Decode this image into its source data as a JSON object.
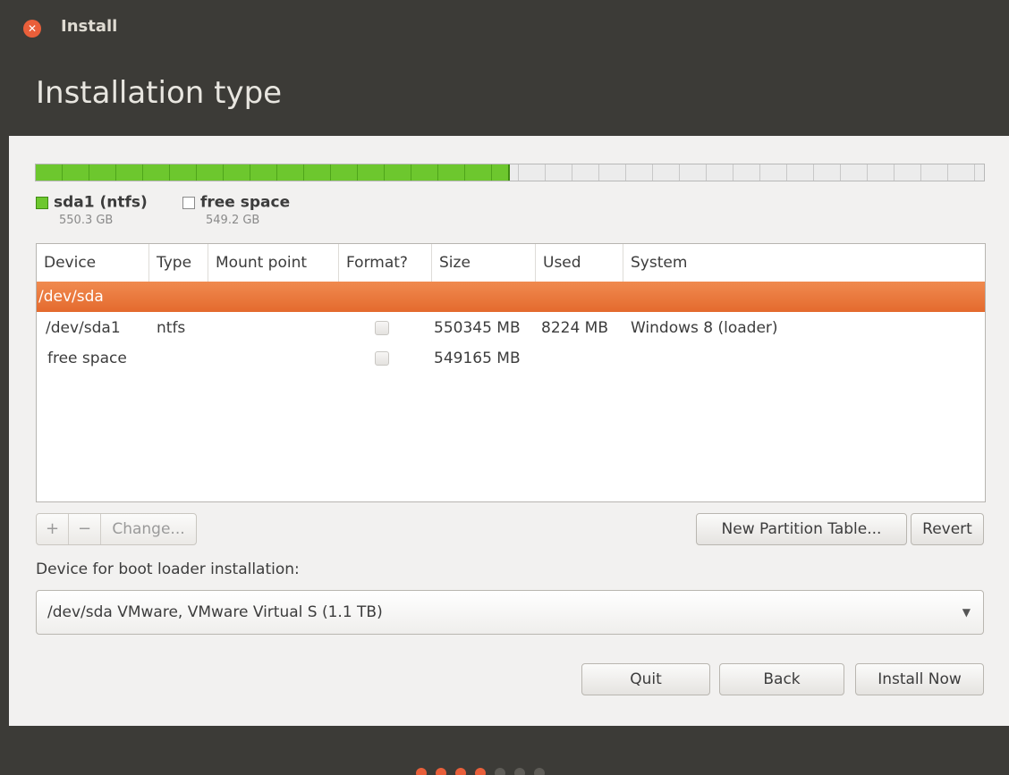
{
  "window": {
    "title": "Install",
    "close_icon": "close-icon"
  },
  "page": {
    "heading": "Installation type"
  },
  "disk_bar": {
    "used_fraction": 0.5,
    "used_color": "#6dc72e",
    "free_color": "#ececec"
  },
  "legend": [
    {
      "name": "sda1 (ntfs)",
      "size": "550.3 GB",
      "color": "#6dc72e"
    },
    {
      "name": "free space",
      "size": "549.2 GB",
      "color": "#ffffff"
    }
  ],
  "table": {
    "headers": [
      "Device",
      "Type",
      "Mount point",
      "Format?",
      "Size",
      "Used",
      "System"
    ],
    "rows": [
      {
        "device": "/dev/sda",
        "type": "",
        "mount": "",
        "format": null,
        "size": "",
        "used": "",
        "system": "",
        "selected": true
      },
      {
        "device": "/dev/sda1",
        "type": "ntfs",
        "mount": "",
        "format": false,
        "size": "550345 MB",
        "used": "8224 MB",
        "system": "Windows 8 (loader)",
        "selected": false
      },
      {
        "device": "free space",
        "type": "",
        "mount": "",
        "format": false,
        "size": "549165 MB",
        "used": "",
        "system": "",
        "selected": false
      }
    ]
  },
  "toolbar": {
    "add_label": "+",
    "remove_label": "−",
    "change_label": "Change...",
    "new_table_label": "New Partition Table...",
    "revert_label": "Revert"
  },
  "bootloader": {
    "label": "Device for boot loader installation:",
    "selected": "/dev/sda   VMware, VMware Virtual S (1.1 TB)"
  },
  "actions": {
    "quit": "Quit",
    "back": "Back",
    "install": "Install Now"
  },
  "progress_dots": {
    "total": 7,
    "done": 4,
    "done_color": "#e95f3a",
    "todo_color": "#5e5c57"
  },
  "colors": {
    "accent": "#e46a2e",
    "titlebar": "#3c3b37"
  }
}
